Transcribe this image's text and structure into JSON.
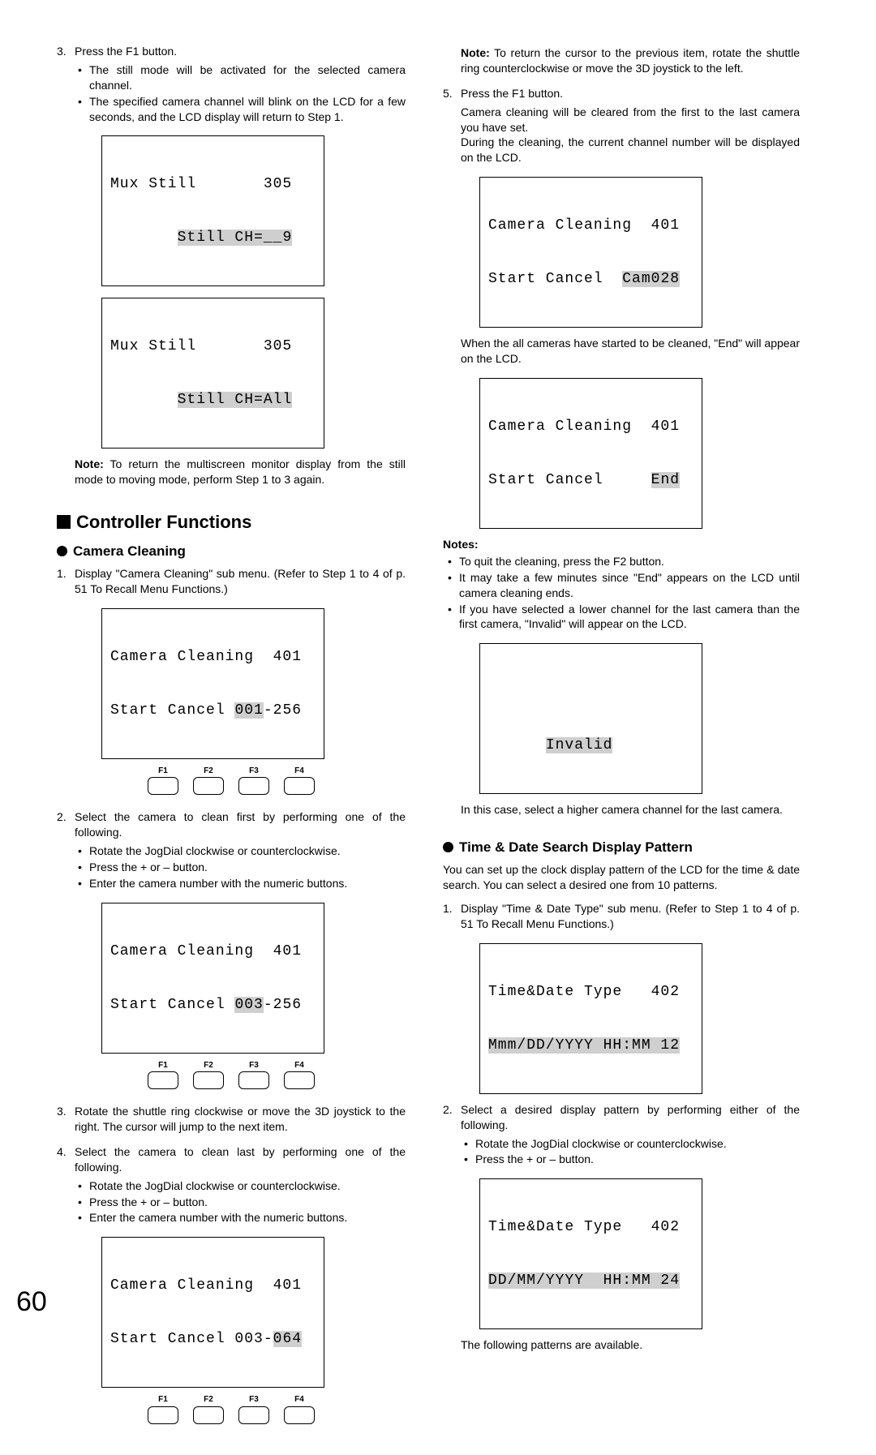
{
  "left": {
    "step3": {
      "n": "3.",
      "t": "Press the F1 button.",
      "b1": "The still mode will be activated for the selected camera channel.",
      "b2": "The specified camera channel will blink on the LCD for a few seconds, and the LCD display will return to Step 1."
    },
    "lcd1": {
      "l1": "Mux Still       305",
      "l2a": "       ",
      "l2b": "Still CH=__9"
    },
    "lcd2": {
      "l1": "Mux Still       305",
      "l2a": "       ",
      "l2b": "Still CH=All"
    },
    "note1": {
      "label": "Note:",
      "text": " To return the multiscreen monitor display from the still mode to moving mode, perform Step 1 to 3 again."
    },
    "section": "Controller Functions",
    "sub_clean": "Camera Cleaning",
    "cc_step1": {
      "n": "1.",
      "t": "Display \"Camera Cleaning\" sub menu. (Refer to Step 1 to 4 of p. 51 To Recall Menu Functions.)"
    },
    "cc_lcd1": {
      "l1": "Camera Cleaning  401",
      "l2a": "Start Cancel ",
      "l2hl": "001",
      "l2b": "-256"
    },
    "cc_step2": {
      "n": "2.",
      "t": "Select the camera to clean first by performing one of the following.",
      "b1": "Rotate the JogDial clockwise or counterclockwise.",
      "b2": "Press the + or – button.",
      "b3": "Enter the camera number with the numeric buttons."
    },
    "cc_lcd2": {
      "l1": "Camera Cleaning  401",
      "l2a": "Start Cancel ",
      "l2hl": "003",
      "l2b": "-256"
    },
    "cc_step3": {
      "n": "3.",
      "t": "Rotate the shuttle ring clockwise or move the 3D joystick to the right. The cursor will jump to the next item."
    },
    "cc_step4": {
      "n": "4.",
      "t": "Select the camera to clean last by performing one of the following.",
      "b1": "Rotate the JogDial clockwise or counterclockwise.",
      "b2": "Press the + or – button.",
      "b3": "Enter the camera number with the numeric buttons."
    },
    "cc_lcd3": {
      "l1": "Camera Cleaning  401",
      "l2a": "Start Cancel 003-",
      "l2hl": "064"
    },
    "fkeys": [
      "F1",
      "F2",
      "F3",
      "F4"
    ]
  },
  "right": {
    "note1": {
      "label": "Note:",
      "text": " To return the cursor to the previous item, rotate the shuttle ring counterclockwise or move the 3D joystick to the left."
    },
    "cc_step5": {
      "n": "5.",
      "t": "Press the F1 button.",
      "p1": "Camera cleaning will be cleared from the first to the last camera you have set.",
      "p2": "During the cleaning, the current channel number will be displayed on the LCD."
    },
    "cc_lcd_a": {
      "l1": "Camera Cleaning  401",
      "l2a": "Start Cancel  ",
      "l2hl": "Cam028"
    },
    "cc_end_text": "When the all cameras have started to be cleaned, \"End\" will appear on the LCD.",
    "cc_lcd_b": {
      "l1": "Camera Cleaning  401",
      "l2a": "Start Cancel     ",
      "l2hl": "End"
    },
    "notes_head": "Notes:",
    "notes": [
      "To quit the cleaning, press the F2 button.",
      "It may take a few minutes since \"End\" appears on the LCD until camera cleaning ends.",
      "If you have selected a lower channel for the last camera than the first camera, \"Invalid\" will appear on the LCD."
    ],
    "cc_lcd_inv": {
      "l1": "                    ",
      "l2a": "      ",
      "l2hl": "Invalid",
      "l2b": "       "
    },
    "inv_tail": "In this case, select a higher camera channel for the last camera.",
    "sub_td": "Time & Date Search Display Pattern",
    "td_intro": "You can set up the clock display pattern of the LCD for the time & date search. You can select a desired one from 10 patterns.",
    "td_step1": {
      "n": "1.",
      "t": "Display \"Time & Date Type\" sub menu. (Refer to Step 1 to 4 of p. 51 To Recall Menu Functions.)"
    },
    "td_lcd1": {
      "l1": "Time&Date Type   402",
      "l2hl": "Mmm/DD/YYYY HH:MM 12"
    },
    "td_step2": {
      "n": "2.",
      "t": "Select a desired display pattern by performing either of the following.",
      "b1": "Rotate the JogDial clockwise or counterclockwise.",
      "b2": "Press the + or – button."
    },
    "td_lcd2": {
      "l1": "Time&Date Type   402",
      "l2hl": "DD/MM/YYYY  HH:MM 24"
    },
    "td_tail": "The following patterns are available."
  },
  "page_number": "60"
}
